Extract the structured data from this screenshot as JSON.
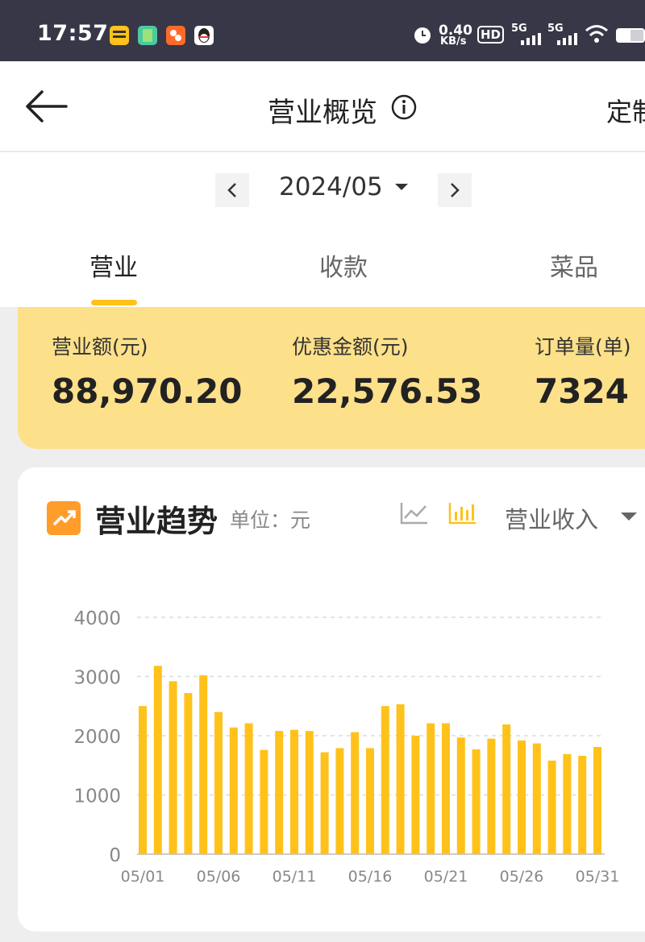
{
  "status_bar": {
    "time": "17:57",
    "net_speed_value": "0.40",
    "net_speed_unit": "KB/s",
    "hd_label": "HD",
    "signal1_label": "5G",
    "signal2_label": "5G",
    "icons": [
      "meituan-manager-app-icon",
      "green-app-icon",
      "orange-app-icon",
      "qq-icon",
      "alarm-icon",
      "wifi-icon",
      "battery-icon"
    ]
  },
  "header": {
    "title": "营业概览",
    "right_action": "定制",
    "back_icon": "back-arrow-icon",
    "info_icon": "info-icon"
  },
  "month_selector": {
    "value": "2024/05"
  },
  "tabs": [
    {
      "label": "营业",
      "active": true
    },
    {
      "label": "收款",
      "active": false
    },
    {
      "label": "菜品",
      "active": false
    }
  ],
  "summary": {
    "metrics": [
      {
        "label": "营业额(元)",
        "value": "88,970.20"
      },
      {
        "label": "优惠金额(元)",
        "value": "22,576.53"
      },
      {
        "label": "订单量(单)",
        "value": "7324"
      }
    ],
    "background_color": "#fde08a"
  },
  "trend": {
    "title": "营业趋势",
    "unit": "单位：元",
    "selected_metric": "营业收入",
    "selected_chart_type": "bar"
  },
  "chart_data": {
    "type": "bar",
    "categories": [
      "05/01",
      "05/02",
      "05/03",
      "05/04",
      "05/05",
      "05/06",
      "05/07",
      "05/08",
      "05/09",
      "05/10",
      "05/11",
      "05/12",
      "05/13",
      "05/14",
      "05/15",
      "05/16",
      "05/17",
      "05/18",
      "05/19",
      "05/20",
      "05/21",
      "05/22",
      "05/23",
      "05/24",
      "05/25",
      "05/26",
      "05/27",
      "05/28",
      "05/29",
      "05/30",
      "05/31"
    ],
    "x_tick_labels": [
      "05/01",
      "05/06",
      "05/11",
      "05/16",
      "05/21",
      "05/26",
      "05/31"
    ],
    "values": [
      2500,
      3180,
      2920,
      2720,
      3020,
      2400,
      2140,
      2210,
      1760,
      2080,
      2100,
      2080,
      1720,
      1790,
      2060,
      1790,
      2500,
      2530,
      2000,
      2210,
      2210,
      1970,
      1770,
      1950,
      2190,
      1920,
      1870,
      1580,
      1690,
      1660,
      1810
    ],
    "ylim": [
      0,
      4000
    ],
    "y_ticks": [
      0,
      1000,
      2000,
      3000,
      4000
    ],
    "grid": true,
    "bar_color": "#ffc21a"
  }
}
